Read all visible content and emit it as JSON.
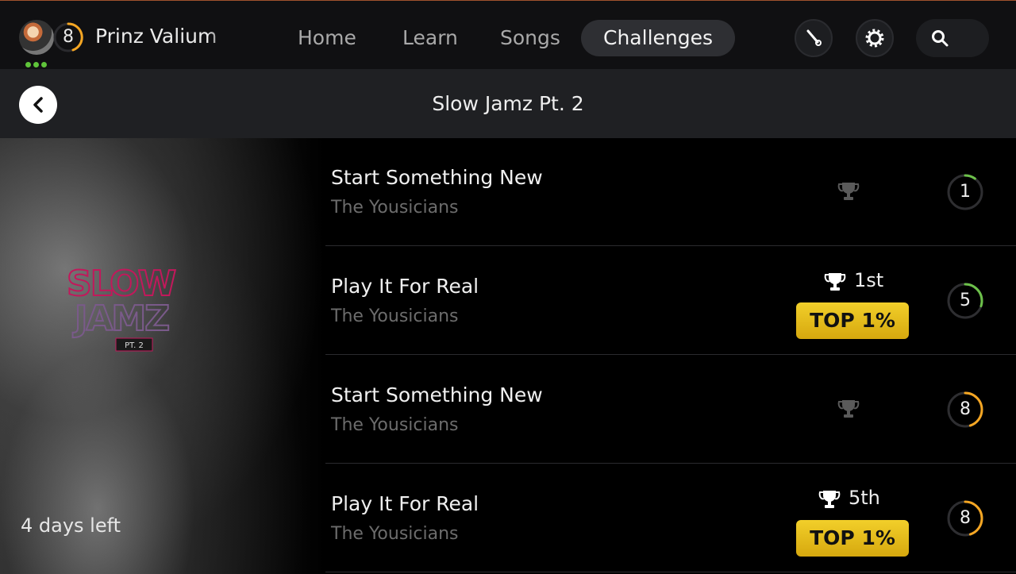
{
  "profile": {
    "name": "Prinz Valium",
    "level": "8"
  },
  "nav": {
    "home": "Home",
    "learn": "Learn",
    "songs": "Songs",
    "challenges": "Challenges"
  },
  "header": {
    "title": "Slow Jamz Pt. 2"
  },
  "art": {
    "line1": "SLOW",
    "line2": "JAMZ",
    "tag": "PT. 2",
    "days_left": "4 days left"
  },
  "colors": {
    "accent_orange": "#f5a623",
    "ring_green": "#6cc04a",
    "badge_gold": "#e8c020"
  },
  "rows": [
    {
      "title": "Start Something New",
      "artist": "The Yousicians",
      "rank": "",
      "badge": "",
      "level": "1",
      "progress": 0.1,
      "ring_color": "#6cc04a",
      "trophy_active": false
    },
    {
      "title": "Play It For Real",
      "artist": "The Yousicians",
      "rank": "1st",
      "badge": "TOP 1%",
      "level": "5",
      "progress": 0.3,
      "ring_color": "#6cc04a",
      "trophy_active": true
    },
    {
      "title": "Start Something New",
      "artist": "The Yousicians",
      "rank": "",
      "badge": "",
      "level": "8",
      "progress": 0.45,
      "ring_color": "#f5a623",
      "trophy_active": false
    },
    {
      "title": "Play It For Real",
      "artist": "The Yousicians",
      "rank": "5th",
      "badge": "TOP 1%",
      "level": "8",
      "progress": 0.45,
      "ring_color": "#f5a623",
      "trophy_active": true
    }
  ]
}
